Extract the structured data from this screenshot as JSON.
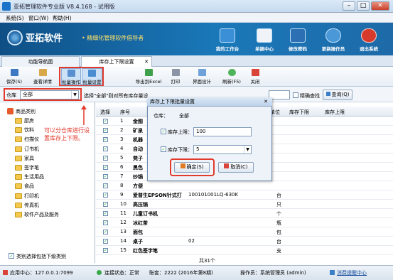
{
  "window": {
    "title": "亚拓管理软件专业版 V8.4.168 - 试用版",
    "min": "–",
    "max": "□",
    "close": "✕"
  },
  "menu": [
    "系统(S)",
    "窗口(W)",
    "帮助(H)"
  ],
  "banner": {
    "logo": "亚拓软件",
    "slogan": "• 精细化管理软件倡导者",
    "buttons": [
      "我的工作台",
      "单据中心",
      "修改密码",
      "更换操作员",
      "退出系统"
    ]
  },
  "tabs": {
    "nav": "功能导航面",
    "active": "库存上下限设置",
    "close": "✕"
  },
  "toolbar": [
    "保存(S)",
    "查看详情",
    "批量操作",
    "批量设置",
    "导出到Excel",
    "打印",
    "界面设计",
    "刷新(F5)",
    "关闭"
  ],
  "filter": {
    "warehouse_label": "仓库",
    "warehouse_value": "全部",
    "hint": "选择\"全部\"则对所有库存量设",
    "fuzzy_label": "精确查找",
    "query_button": "查询(Q)"
  },
  "tree": {
    "root": "商品类别",
    "items": [
      "厨房",
      "饮料",
      "扫描仪",
      "订书机",
      "家具",
      "签字笔",
      "生活用品",
      "食品",
      "打印机",
      "传真机",
      "软件产品及服务"
    ],
    "include_sub": "类别选择包括下级类别"
  },
  "annotation": "可以分仓库进行设置库存上下限。",
  "grid": {
    "columns": [
      "选择",
      "序号",
      "单位",
      "库存下限",
      "库存上限"
    ],
    "rows": [
      {
        "no": "1",
        "name": "金图",
        "code": "",
        "spec": "",
        "unit": ""
      },
      {
        "no": "2",
        "name": "矿泉",
        "code": "",
        "spec": "",
        "unit": ""
      },
      {
        "no": "3",
        "name": "机器",
        "code": "",
        "spec": "",
        "unit": ""
      },
      {
        "no": "4",
        "name": "自动",
        "code": "",
        "spec": "",
        "unit": ""
      },
      {
        "no": "5",
        "name": "凳子",
        "code": "",
        "spec": "",
        "unit": ""
      },
      {
        "no": "6",
        "name": "黑色",
        "code": "",
        "spec": "",
        "unit": ""
      },
      {
        "no": "7",
        "name": "炒锅",
        "code": "",
        "spec": "",
        "unit": ""
      },
      {
        "no": "8",
        "name": "方便",
        "code": "",
        "spec": "",
        "unit": ""
      },
      {
        "no": "9",
        "name": "爱普生EPSON针式打",
        "code": "100101001",
        "spec": "LQ-630K",
        "unit": "台"
      },
      {
        "no": "10",
        "name": "高压锅",
        "code": "",
        "spec": "",
        "unit": "只"
      },
      {
        "no": "11",
        "name": "儿童订书机",
        "code": "",
        "spec": "",
        "unit": "个"
      },
      {
        "no": "12",
        "name": "冰红茶",
        "code": "",
        "spec": "",
        "unit": "瓶"
      },
      {
        "no": "13",
        "name": "面包",
        "code": "",
        "spec": "",
        "unit": "包"
      },
      {
        "no": "14",
        "name": "桌子",
        "code": "02",
        "spec": "",
        "unit": "台"
      },
      {
        "no": "15",
        "name": "红色签字笔",
        "code": "",
        "spec": "",
        "unit": "支"
      }
    ],
    "total": "共31个"
  },
  "dialog": {
    "title": "库存上下限批量设置",
    "warehouse_label": "仓库：",
    "warehouse_value": "全部",
    "upper_label": "库存上限：",
    "upper_value": "100",
    "lower_label": "库存下限：",
    "lower_value": "5",
    "ok": "确定(S)",
    "cancel": "取消(C)"
  },
  "status": {
    "app_center": "应用中心：127.0.0.1:7099",
    "connection": "连接状态：正常",
    "account": "账套：2222 (2016年第8期)",
    "operator": "操作员：系统管理员 (admin)",
    "message": "消费提醒中心"
  },
  "colors": {
    "banner": "#1a78b9",
    "accent_red": "#e23a2c",
    "slogan": "#ffe36b"
  }
}
